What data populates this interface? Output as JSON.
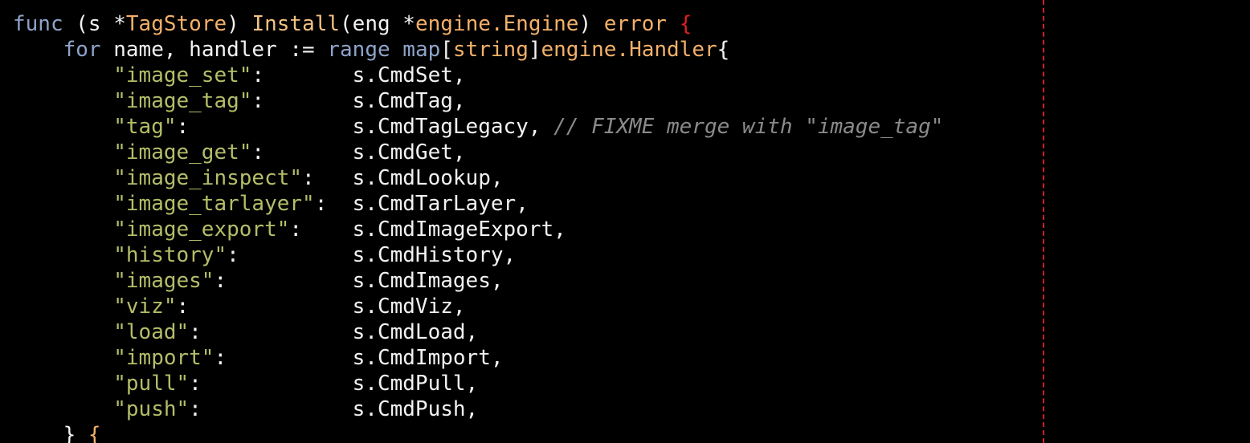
{
  "editor": {
    "lines": [
      {
        "tokens": [
          {
            "t": "func",
            "c": "kw"
          },
          {
            "t": " (s *",
            "c": "plain"
          },
          {
            "t": "TagStore",
            "c": "ty"
          },
          {
            "t": ") ",
            "c": "plain"
          },
          {
            "t": "Install",
            "c": "fn"
          },
          {
            "t": "(eng *",
            "c": "plain"
          },
          {
            "t": "engine.Engine",
            "c": "ty"
          },
          {
            "t": ") ",
            "c": "plain"
          },
          {
            "t": "error",
            "c": "ty"
          },
          {
            "t": " ",
            "c": "plain"
          },
          {
            "t": "{",
            "c": "brace-red"
          }
        ]
      },
      {
        "tokens": [
          {
            "t": "    ",
            "c": "plain"
          },
          {
            "t": "for",
            "c": "kw"
          },
          {
            "t": " name, handler := ",
            "c": "plain"
          },
          {
            "t": "range",
            "c": "kw"
          },
          {
            "t": " ",
            "c": "plain"
          },
          {
            "t": "map",
            "c": "kw"
          },
          {
            "t": "[",
            "c": "plain"
          },
          {
            "t": "string",
            "c": "ty"
          },
          {
            "t": "]",
            "c": "plain"
          },
          {
            "t": "engine.Handler",
            "c": "ty"
          },
          {
            "t": "{",
            "c": "plain"
          }
        ]
      },
      {
        "tokens": [
          {
            "t": "        ",
            "c": "plain"
          },
          {
            "t": "\"image_set\"",
            "c": "str"
          },
          {
            "t": ":       s.CmdSet,",
            "c": "plain"
          }
        ]
      },
      {
        "tokens": [
          {
            "t": "        ",
            "c": "plain"
          },
          {
            "t": "\"image_tag\"",
            "c": "str"
          },
          {
            "t": ":       s.CmdTag,",
            "c": "plain"
          }
        ]
      },
      {
        "tokens": [
          {
            "t": "        ",
            "c": "plain"
          },
          {
            "t": "\"tag\"",
            "c": "str"
          },
          {
            "t": ":             s.CmdTagLegacy, ",
            "c": "plain"
          },
          {
            "t": "// FIXME merge with \"image_tag\"",
            "c": "cm"
          }
        ]
      },
      {
        "tokens": [
          {
            "t": "        ",
            "c": "plain"
          },
          {
            "t": "\"image_get\"",
            "c": "str"
          },
          {
            "t": ":       s.CmdGet,",
            "c": "plain"
          }
        ]
      },
      {
        "tokens": [
          {
            "t": "        ",
            "c": "plain"
          },
          {
            "t": "\"image_inspect\"",
            "c": "str"
          },
          {
            "t": ":   s.CmdLookup,",
            "c": "plain"
          }
        ]
      },
      {
        "tokens": [
          {
            "t": "        ",
            "c": "plain"
          },
          {
            "t": "\"image_tarlayer\"",
            "c": "str"
          },
          {
            "t": ":  s.CmdTarLayer,",
            "c": "plain"
          }
        ]
      },
      {
        "tokens": [
          {
            "t": "        ",
            "c": "plain"
          },
          {
            "t": "\"image_export\"",
            "c": "str"
          },
          {
            "t": ":    s.CmdImageExport,",
            "c": "plain"
          }
        ]
      },
      {
        "tokens": [
          {
            "t": "        ",
            "c": "plain"
          },
          {
            "t": "\"history\"",
            "c": "str"
          },
          {
            "t": ":         s.CmdHistory,",
            "c": "plain"
          }
        ]
      },
      {
        "tokens": [
          {
            "t": "        ",
            "c": "plain"
          },
          {
            "t": "\"images\"",
            "c": "str"
          },
          {
            "t": ":          s.CmdImages,",
            "c": "plain"
          }
        ]
      },
      {
        "tokens": [
          {
            "t": "        ",
            "c": "plain"
          },
          {
            "t": "\"viz\"",
            "c": "str"
          },
          {
            "t": ":             s.CmdViz,",
            "c": "plain"
          }
        ]
      },
      {
        "tokens": [
          {
            "t": "        ",
            "c": "plain"
          },
          {
            "t": "\"load\"",
            "c": "str"
          },
          {
            "t": ":            s.CmdLoad,",
            "c": "plain"
          }
        ]
      },
      {
        "tokens": [
          {
            "t": "        ",
            "c": "plain"
          },
          {
            "t": "\"import\"",
            "c": "str"
          },
          {
            "t": ":          s.CmdImport,",
            "c": "plain"
          }
        ]
      },
      {
        "tokens": [
          {
            "t": "        ",
            "c": "plain"
          },
          {
            "t": "\"pull\"",
            "c": "str"
          },
          {
            "t": ":            s.CmdPull,",
            "c": "plain"
          }
        ]
      },
      {
        "tokens": [
          {
            "t": "        ",
            "c": "plain"
          },
          {
            "t": "\"push\"",
            "c": "str"
          },
          {
            "t": ":            s.CmdPush,",
            "c": "plain"
          }
        ]
      },
      {
        "tokens": [
          {
            "t": "    } ",
            "c": "plain"
          },
          {
            "t": "{",
            "c": "brace-or"
          }
        ]
      }
    ],
    "colors": {
      "background": "#000000",
      "keyword": "#8ea3c9",
      "type": "#f3b06a",
      "string": "#b5bd68",
      "comment": "#8a8a8a",
      "text": "#f2f2f2",
      "margin_guide": "#d21f1f"
    }
  }
}
